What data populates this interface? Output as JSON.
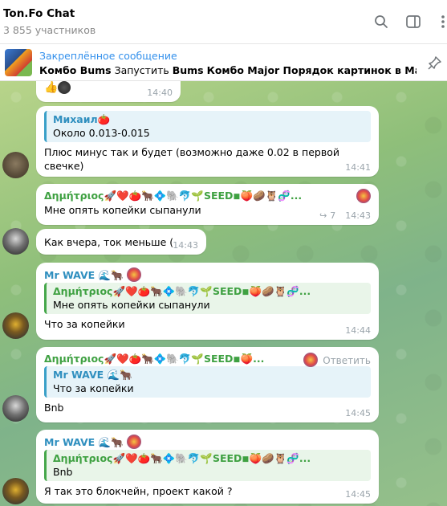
{
  "header": {
    "title": "Ton.Fo Chat",
    "members": "3 855 участников"
  },
  "pinned": {
    "title": "Закреплённое сообщение",
    "text_bold_1": "Комбо Bums",
    "text_1": " Запустить ",
    "text_bold_2": "Bums",
    "text_2": "  ",
    "text_bold_3": "Комбо Major Порядок картинок в Major...",
    "text_3": ""
  },
  "messages": [
    {
      "id": "m0",
      "reactions": "👍",
      "time": "14:40"
    },
    {
      "id": "m1",
      "reply_name": "Михаил🍅",
      "reply_text": "Около 0.013-0.015",
      "text": "Плюс минус так и будет (возможно даже 0.02 в первой свечке)",
      "time": "14:41"
    },
    {
      "id": "m2",
      "sender": "Δημήτριος🚀❤️🍅🐂💠🐘🐬🌱SEED◾🍑🥔🦉🧬...",
      "text": "Мне опять копейки сыпанули",
      "replies": "7",
      "time": "14:43"
    },
    {
      "id": "m3",
      "text": "Как вчера, ток меньше (",
      "time": "14:43"
    },
    {
      "id": "m4",
      "sender": "Mr WAVE 🌊🐂",
      "reply_name": "Δημήτριος🚀❤️🍅🐂💠🐘🐬🌱SEED◾🍑🥔🦉🧬...",
      "reply_text": "Мне опять копейки сыпанули",
      "text": "Что за копейки",
      "time": "14:44"
    },
    {
      "id": "m5",
      "sender": "Δημήτριος🚀❤️🍅🐂💠🐘🐬🌱SEED◾🍑...",
      "reply_action": "Ответить",
      "reply_name": "Mr WAVE 🌊🐂",
      "reply_text": "Что за копейки",
      "text": "Bnb",
      "time": "14:45"
    },
    {
      "id": "m6",
      "sender": "Mr WAVE 🌊🐂",
      "reply_name": "Δημήτριος🚀❤️🍅🐂💠🐘🐬🌱SEED◾🍑🥔🦉🧬...",
      "reply_text": "Bnb",
      "text": "Я так это блокчейн,  проект какой ?",
      "time": "14:45"
    }
  ],
  "colors": {
    "accent": "#3390ec",
    "name_green": "#3fa142",
    "name_blue": "#2f8fbf",
    "name_red": "#c7372d"
  }
}
